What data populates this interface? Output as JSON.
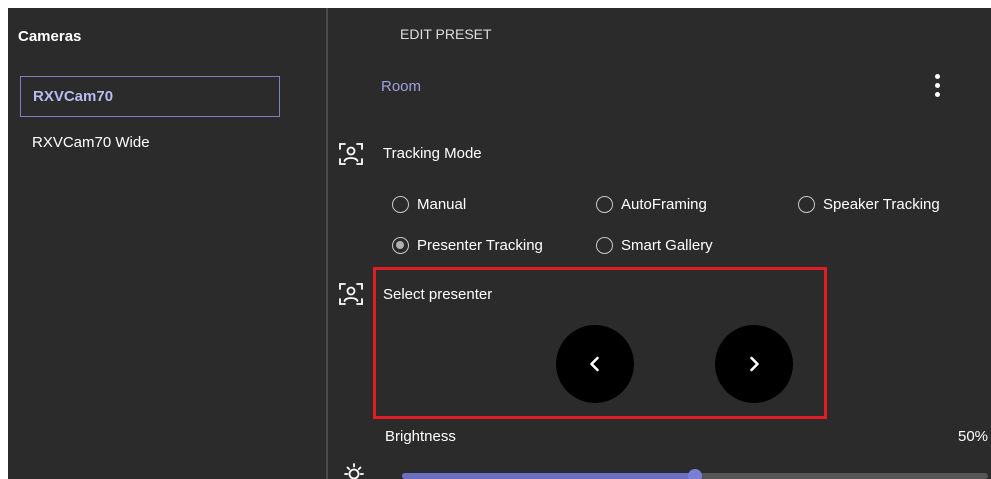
{
  "sidebar": {
    "title": "Cameras",
    "items": [
      {
        "label": "RXVCam70",
        "selected": true
      },
      {
        "label": "RXVCam70 Wide",
        "selected": false
      }
    ]
  },
  "main": {
    "header": "EDIT PRESET",
    "preset_name": "Room",
    "tracking_mode": {
      "label": "Tracking Mode",
      "icon": "person-tracking-icon",
      "options": [
        {
          "label": "Manual",
          "selected": false
        },
        {
          "label": "AutoFraming",
          "selected": false
        },
        {
          "label": "Speaker Tracking",
          "selected": false
        },
        {
          "label": "Presenter Tracking",
          "selected": true
        },
        {
          "label": "Smart Gallery",
          "selected": false
        }
      ]
    },
    "select_presenter": {
      "label": "Select presenter",
      "icon": "person-tracking-icon",
      "prev_icon": "chevron-left-icon",
      "next_icon": "chevron-right-icon"
    },
    "brightness": {
      "label": "Brightness",
      "value_text": "50%",
      "value": 0.5,
      "icon": "sun-icon"
    }
  },
  "colors": {
    "background": "#2b2b2b",
    "accent": "#9da0e0",
    "highlight": "#e11d24"
  }
}
